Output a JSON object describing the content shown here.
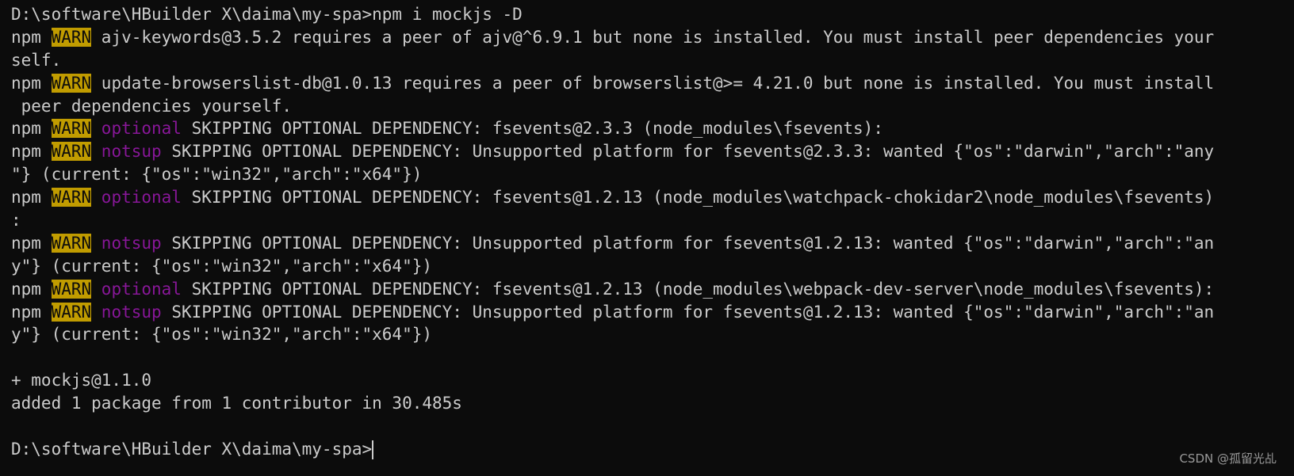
{
  "terminal": {
    "colors": {
      "background": "#0c0c0c",
      "text": "#cccccc",
      "warn_bg": "#c19c00",
      "keyword": "#881798"
    },
    "lines": [
      {
        "text": "D:\\software\\HBuilder X\\daima\\my-spa>npm i mockjs -D"
      },
      {
        "prefix": "npm ",
        "warn": "WARN",
        "rest": " ajv-keywords@3.5.2 requires a peer of ajv@^6.9.1 but none is installed. You must install peer dependencies your"
      },
      {
        "text": "self."
      },
      {
        "prefix": "npm ",
        "warn": "WARN",
        "rest": " update-browserslist-db@1.0.13 requires a peer of browserslist@>= 4.21.0 but none is installed. You must install"
      },
      {
        "text": " peer dependencies yourself."
      },
      {
        "prefix": "npm ",
        "warn": "WARN",
        "kw": " optional",
        "rest": " SKIPPING OPTIONAL DEPENDENCY: fsevents@2.3.3 (node_modules\\fsevents):"
      },
      {
        "prefix": "npm ",
        "warn": "WARN",
        "kw": " notsup",
        "rest": " SKIPPING OPTIONAL DEPENDENCY: Unsupported platform for fsevents@2.3.3: wanted {\"os\":\"darwin\",\"arch\":\"any"
      },
      {
        "text": "\"} (current: {\"os\":\"win32\",\"arch\":\"x64\"})"
      },
      {
        "prefix": "npm ",
        "warn": "WARN",
        "kw": " optional",
        "rest": " SKIPPING OPTIONAL DEPENDENCY: fsevents@1.2.13 (node_modules\\watchpack-chokidar2\\node_modules\\fsevents)"
      },
      {
        "text": ":"
      },
      {
        "prefix": "npm ",
        "warn": "WARN",
        "kw": " notsup",
        "rest": " SKIPPING OPTIONAL DEPENDENCY: Unsupported platform for fsevents@1.2.13: wanted {\"os\":\"darwin\",\"arch\":\"an"
      },
      {
        "text": "y\"} (current: {\"os\":\"win32\",\"arch\":\"x64\"})"
      },
      {
        "prefix": "npm ",
        "warn": "WARN",
        "kw": " optional",
        "rest": " SKIPPING OPTIONAL DEPENDENCY: fsevents@1.2.13 (node_modules\\webpack-dev-server\\node_modules\\fsevents):"
      },
      {
        "prefix": "npm ",
        "warn": "WARN",
        "kw": " notsup",
        "rest": " SKIPPING OPTIONAL DEPENDENCY: Unsupported platform for fsevents@1.2.13: wanted {\"os\":\"darwin\",\"arch\":\"an"
      },
      {
        "text": "y\"} (current: {\"os\":\"win32\",\"arch\":\"x64\"})"
      },
      {
        "text": ""
      },
      {
        "text": "+ mockjs@1.1.0"
      },
      {
        "text": "added 1 package from 1 contributor in 30.485s"
      },
      {
        "text": ""
      },
      {
        "text": "D:\\software\\HBuilder X\\daima\\my-spa>",
        "cursor": true
      }
    ]
  },
  "watermark": "CSDN @孤留光乩"
}
